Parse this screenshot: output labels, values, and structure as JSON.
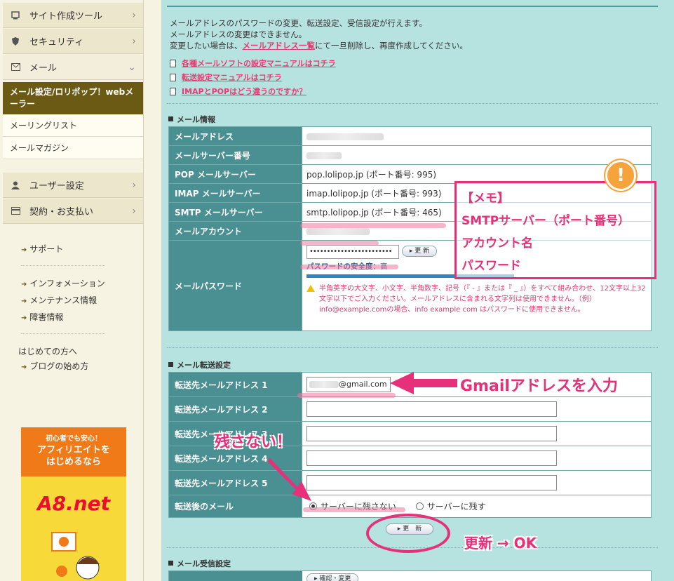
{
  "sidebar": {
    "menu": [
      {
        "label": "サイト作成ツール",
        "icon": "monitor-icon"
      },
      {
        "label": "セキュリティ",
        "icon": "shield-icon"
      },
      {
        "label": "メール",
        "icon": "envelope-icon"
      }
    ],
    "active": "メール設定/ロリポップ！webメーラー",
    "sub_items": [
      "メーリングリスト",
      "メールマガジン"
    ],
    "menu2": [
      {
        "label": "ユーザー設定",
        "icon": "user-icon"
      },
      {
        "label": "契約・お支払い",
        "icon": "card-icon"
      }
    ],
    "links": [
      "サポート",
      "インフォメーション",
      "メンテナンス情報",
      "障害情報"
    ],
    "beginner_title": "はじめての方へ",
    "beginner_link": "ブログの始め方",
    "banner": {
      "line1": "初心者でも安心！",
      "line2": "アフィリエイトを",
      "line3": "はじめるなら",
      "logo": "A8.net"
    }
  },
  "main": {
    "intro1": "メールアドレスのパスワードの変更、転送設定、受信設定が行えます。",
    "intro2": "メールアドレスの変更はできません。",
    "intro3a": "変更したい場合は、",
    "intro3link": "メールアドレス一覧",
    "intro3b": "にて一旦削除し、再度作成してください。",
    "manuals": [
      "各種メールソフトの設定マニュアルはコチラ",
      "転送設定マニュアルはコチラ",
      "IMAPとPOPはどう違うのですか？"
    ],
    "info_title": "メール情報",
    "info": {
      "address_label": "メールアドレス",
      "server_no_label": "メールサーバー番号",
      "pop_label": "POP メールサーバー",
      "pop_value": "pop.lolipop.jp (ポート番号: 995)",
      "imap_label": "IMAP メールサーバー",
      "imap_value": "imap.lolipop.jp (ポート番号: 993)",
      "smtp_label": "SMTP メールサーバー",
      "smtp_value": "smtp.lolipop.jp (ポート番号: 465)",
      "account_label": "メールアカウント",
      "password_label": "メールパスワード",
      "password_value": "••••••••••••••••••••••••",
      "update_label": "更 新",
      "strength_label": "パスワードの安全度：",
      "strength_value": "高",
      "warning": "半角英字の大文字、小文字、半角数字、記号（『 - 』または『 _ 』）をすべて組み合わせ、12文字以上32文字以下でご入力ください。メールアドレスに含まれる文字列は使用できません。（例）info@example.comの場合、info example com はパスワードに使用できません。"
    },
    "forward_title": "メール転送設定",
    "forward": {
      "rows": [
        "転送先メールアドレス 1",
        "転送先メールアドレス 2",
        "転送先メールアドレス 3",
        "転送先メールアドレス 4",
        "転送先メールアドレス 5"
      ],
      "address1_value": "@gmail.com",
      "after_label": "転送後のメール",
      "option1": "サーバーに残さない",
      "option2": "サーバーに残す",
      "update_label": "更　新"
    },
    "receive_title": "メール受信設定",
    "receive_btn": "確認・変更"
  },
  "annotations": {
    "memo": [
      "【メモ】",
      "SMTPサーバー（ポート番号）",
      "アカウント名",
      "パスワード"
    ],
    "excl": "!",
    "gmail": "Gmailアドレスを入力",
    "nokosanai": "残さない！",
    "koushin": "更新 → OK",
    "color": "#e6317a"
  }
}
